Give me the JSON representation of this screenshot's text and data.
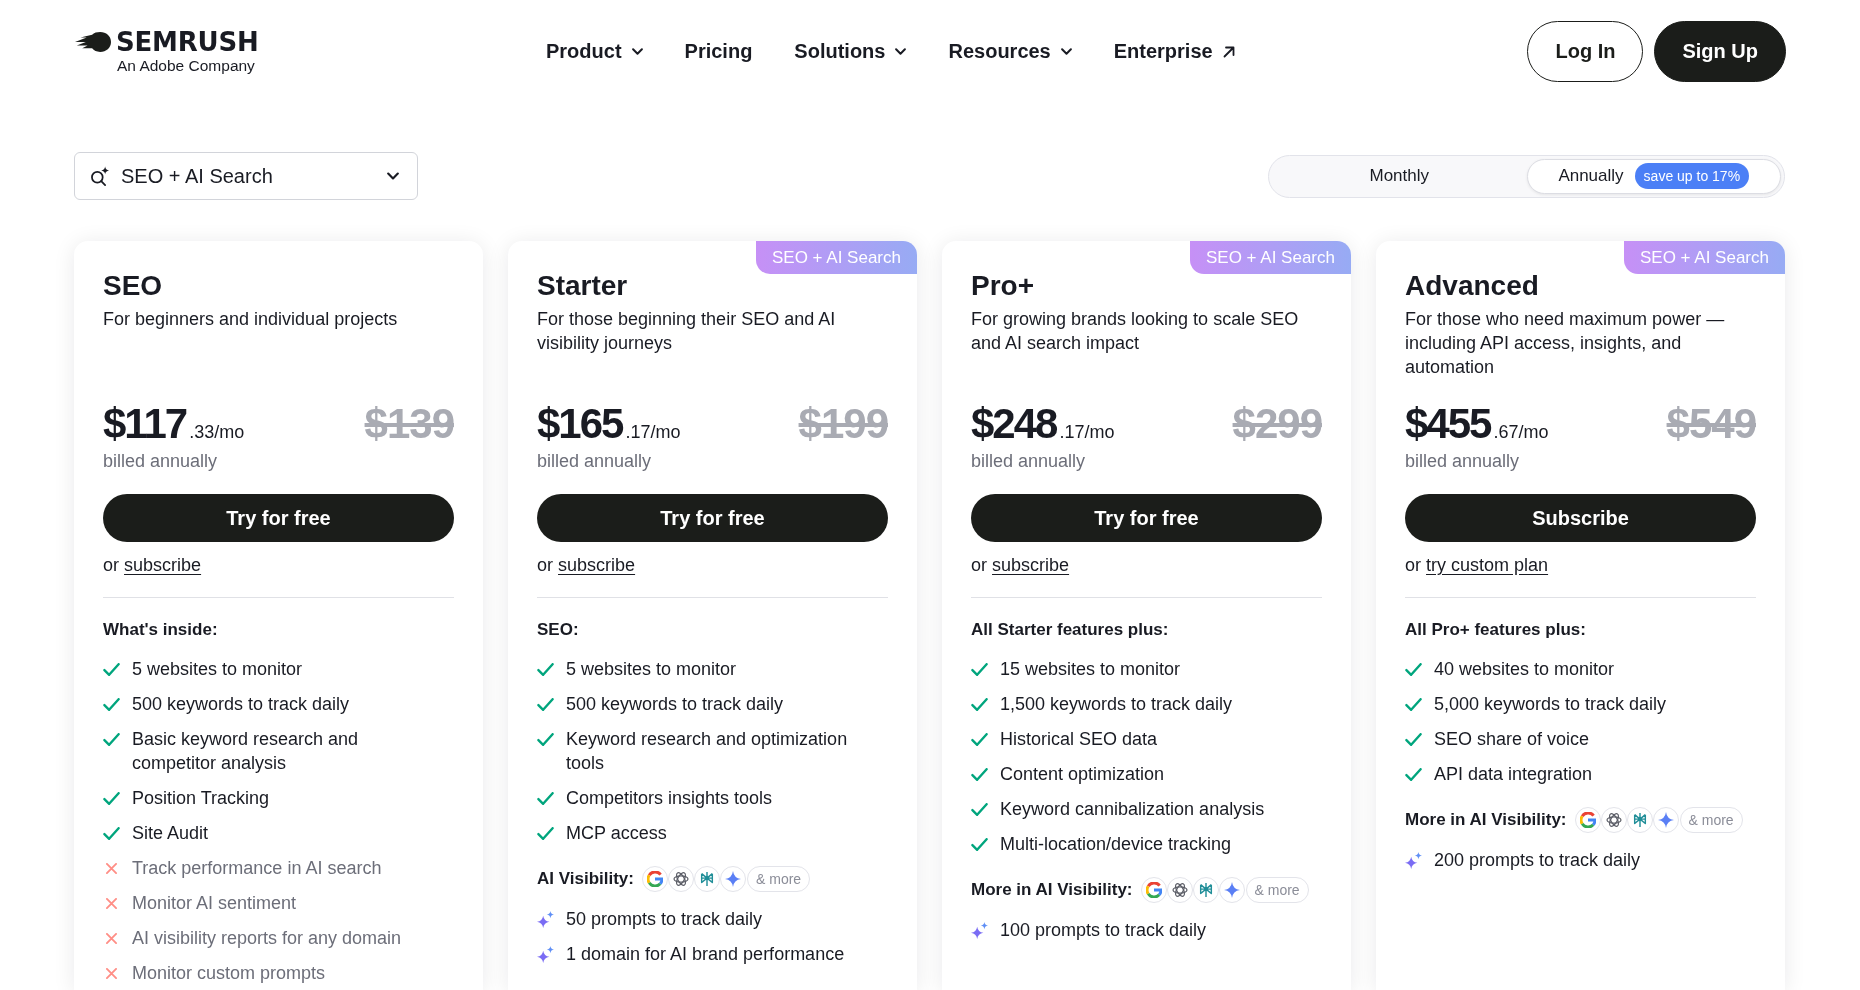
{
  "header": {
    "logo": {
      "wordmark": "SEMRUSH",
      "tagline": "An Adobe Company"
    },
    "nav": [
      {
        "label": "Product",
        "kind": "menu"
      },
      {
        "label": "Pricing",
        "kind": "link"
      },
      {
        "label": "Solutions",
        "kind": "menu"
      },
      {
        "label": "Resources",
        "kind": "menu"
      },
      {
        "label": "Enterprise",
        "kind": "external"
      }
    ],
    "buttons": [
      {
        "label": "Log In",
        "kind": "outline"
      },
      {
        "label": "Sign Up",
        "kind": "solid"
      }
    ]
  },
  "plan_filter": {
    "value": "SEO + AI Search"
  },
  "billing_toggle": [
    {
      "label": "Monthly",
      "selected": false
    },
    {
      "label": "Annually",
      "selected": true,
      "badge": "save up to 17%"
    }
  ],
  "plans": [
    {
      "name": "SEO",
      "description": "For beginners and individual projects",
      "price": "$117",
      "price_period": ".33/mo",
      "old_price": "$139",
      "billing_note": "billed annually",
      "cta": "Try for free",
      "alt_prefix": "or",
      "alt_link": "subscribe",
      "sections": [
        {
          "heading": "What's inside:",
          "items": [
            {
              "text": "5 websites to monitor",
              "kind": "included"
            },
            {
              "text": "500 keywords to track daily",
              "kind": "included"
            },
            {
              "text": "Basic keyword research and competitor analysis",
              "kind": "included"
            },
            {
              "text": "Position Tracking",
              "kind": "included"
            },
            {
              "text": "Site Audit",
              "kind": "included"
            },
            {
              "text": "Track performance in AI search",
              "kind": "excluded"
            },
            {
              "text": "Monitor AI sentiment",
              "kind": "excluded"
            },
            {
              "text": "AI visibility reports for any domain",
              "kind": "excluded"
            },
            {
              "text": "Monitor custom prompts",
              "kind": "excluded"
            }
          ]
        }
      ]
    },
    {
      "ribbon": "SEO + AI Search",
      "name": "Starter",
      "description": "For those beginning their SEO and AI visibility journeys",
      "price": "$165",
      "price_period": ".17/mo",
      "old_price": "$199",
      "billing_note": "billed annually",
      "cta": "Try for free",
      "alt_prefix": "or",
      "alt_link": "subscribe",
      "sections": [
        {
          "heading": "SEO:",
          "items": [
            {
              "text": "5 websites to monitor",
              "kind": "included"
            },
            {
              "text": "500 keywords to track daily",
              "kind": "included"
            },
            {
              "text": "Keyword research and optimization tools",
              "kind": "included"
            },
            {
              "text": "Competitors insights tools",
              "kind": "included"
            },
            {
              "text": "MCP access",
              "kind": "included"
            }
          ]
        },
        {
          "heading": "AI Visibility:",
          "provider_logos": {
            "more": "& more"
          },
          "items": [
            {
              "text": "50 prompts to track daily",
              "kind": "ai"
            },
            {
              "text": "1 domain for AI brand performance",
              "kind": "ai"
            }
          ]
        }
      ]
    },
    {
      "ribbon": "SEO + AI Search",
      "name": "Pro+",
      "description": "For growing brands looking to scale SEO and AI search impact",
      "price": "$248",
      "price_period": ".17/mo",
      "old_price": "$299",
      "billing_note": "billed annually",
      "cta": "Try for free",
      "alt_prefix": "or",
      "alt_link": "subscribe",
      "sections": [
        {
          "heading": "All Starter features plus:",
          "items": [
            {
              "text": "15 websites to monitor",
              "kind": "included"
            },
            {
              "text": "1,500 keywords to track daily",
              "kind": "included"
            },
            {
              "text": "Historical SEO data",
              "kind": "included"
            },
            {
              "text": "Content optimization",
              "kind": "included"
            },
            {
              "text": "Keyword cannibalization analysis",
              "kind": "included"
            },
            {
              "text": "Multi-location/device tracking",
              "kind": "included"
            }
          ]
        },
        {
          "heading": "More in AI Visibility:",
          "provider_logos": {
            "more": "& more"
          },
          "items": [
            {
              "text": "100 prompts to track daily",
              "kind": "ai"
            }
          ]
        }
      ]
    },
    {
      "ribbon": "SEO + AI Search",
      "name": "Advanced",
      "description": "For those who need maximum power — including API access, insights, and automation",
      "price": "$455",
      "price_period": ".67/mo",
      "old_price": "$549",
      "billing_note": "billed annually",
      "cta": "Subscribe",
      "alt_prefix": "or",
      "alt_link": "try custom plan",
      "sections": [
        {
          "heading": "All Pro+ features plus:",
          "items": [
            {
              "text": "40 websites to monitor",
              "kind": "included"
            },
            {
              "text": "5,000 keywords to track daily",
              "kind": "included"
            },
            {
              "text": "SEO share of voice",
              "kind": "included"
            },
            {
              "text": "API data integration",
              "kind": "included"
            }
          ]
        },
        {
          "heading": "More in AI Visibility:",
          "provider_logos": {
            "more": "& more"
          },
          "items": [
            {
              "text": "200 prompts to track daily",
              "kind": "ai"
            }
          ]
        }
      ]
    }
  ]
}
